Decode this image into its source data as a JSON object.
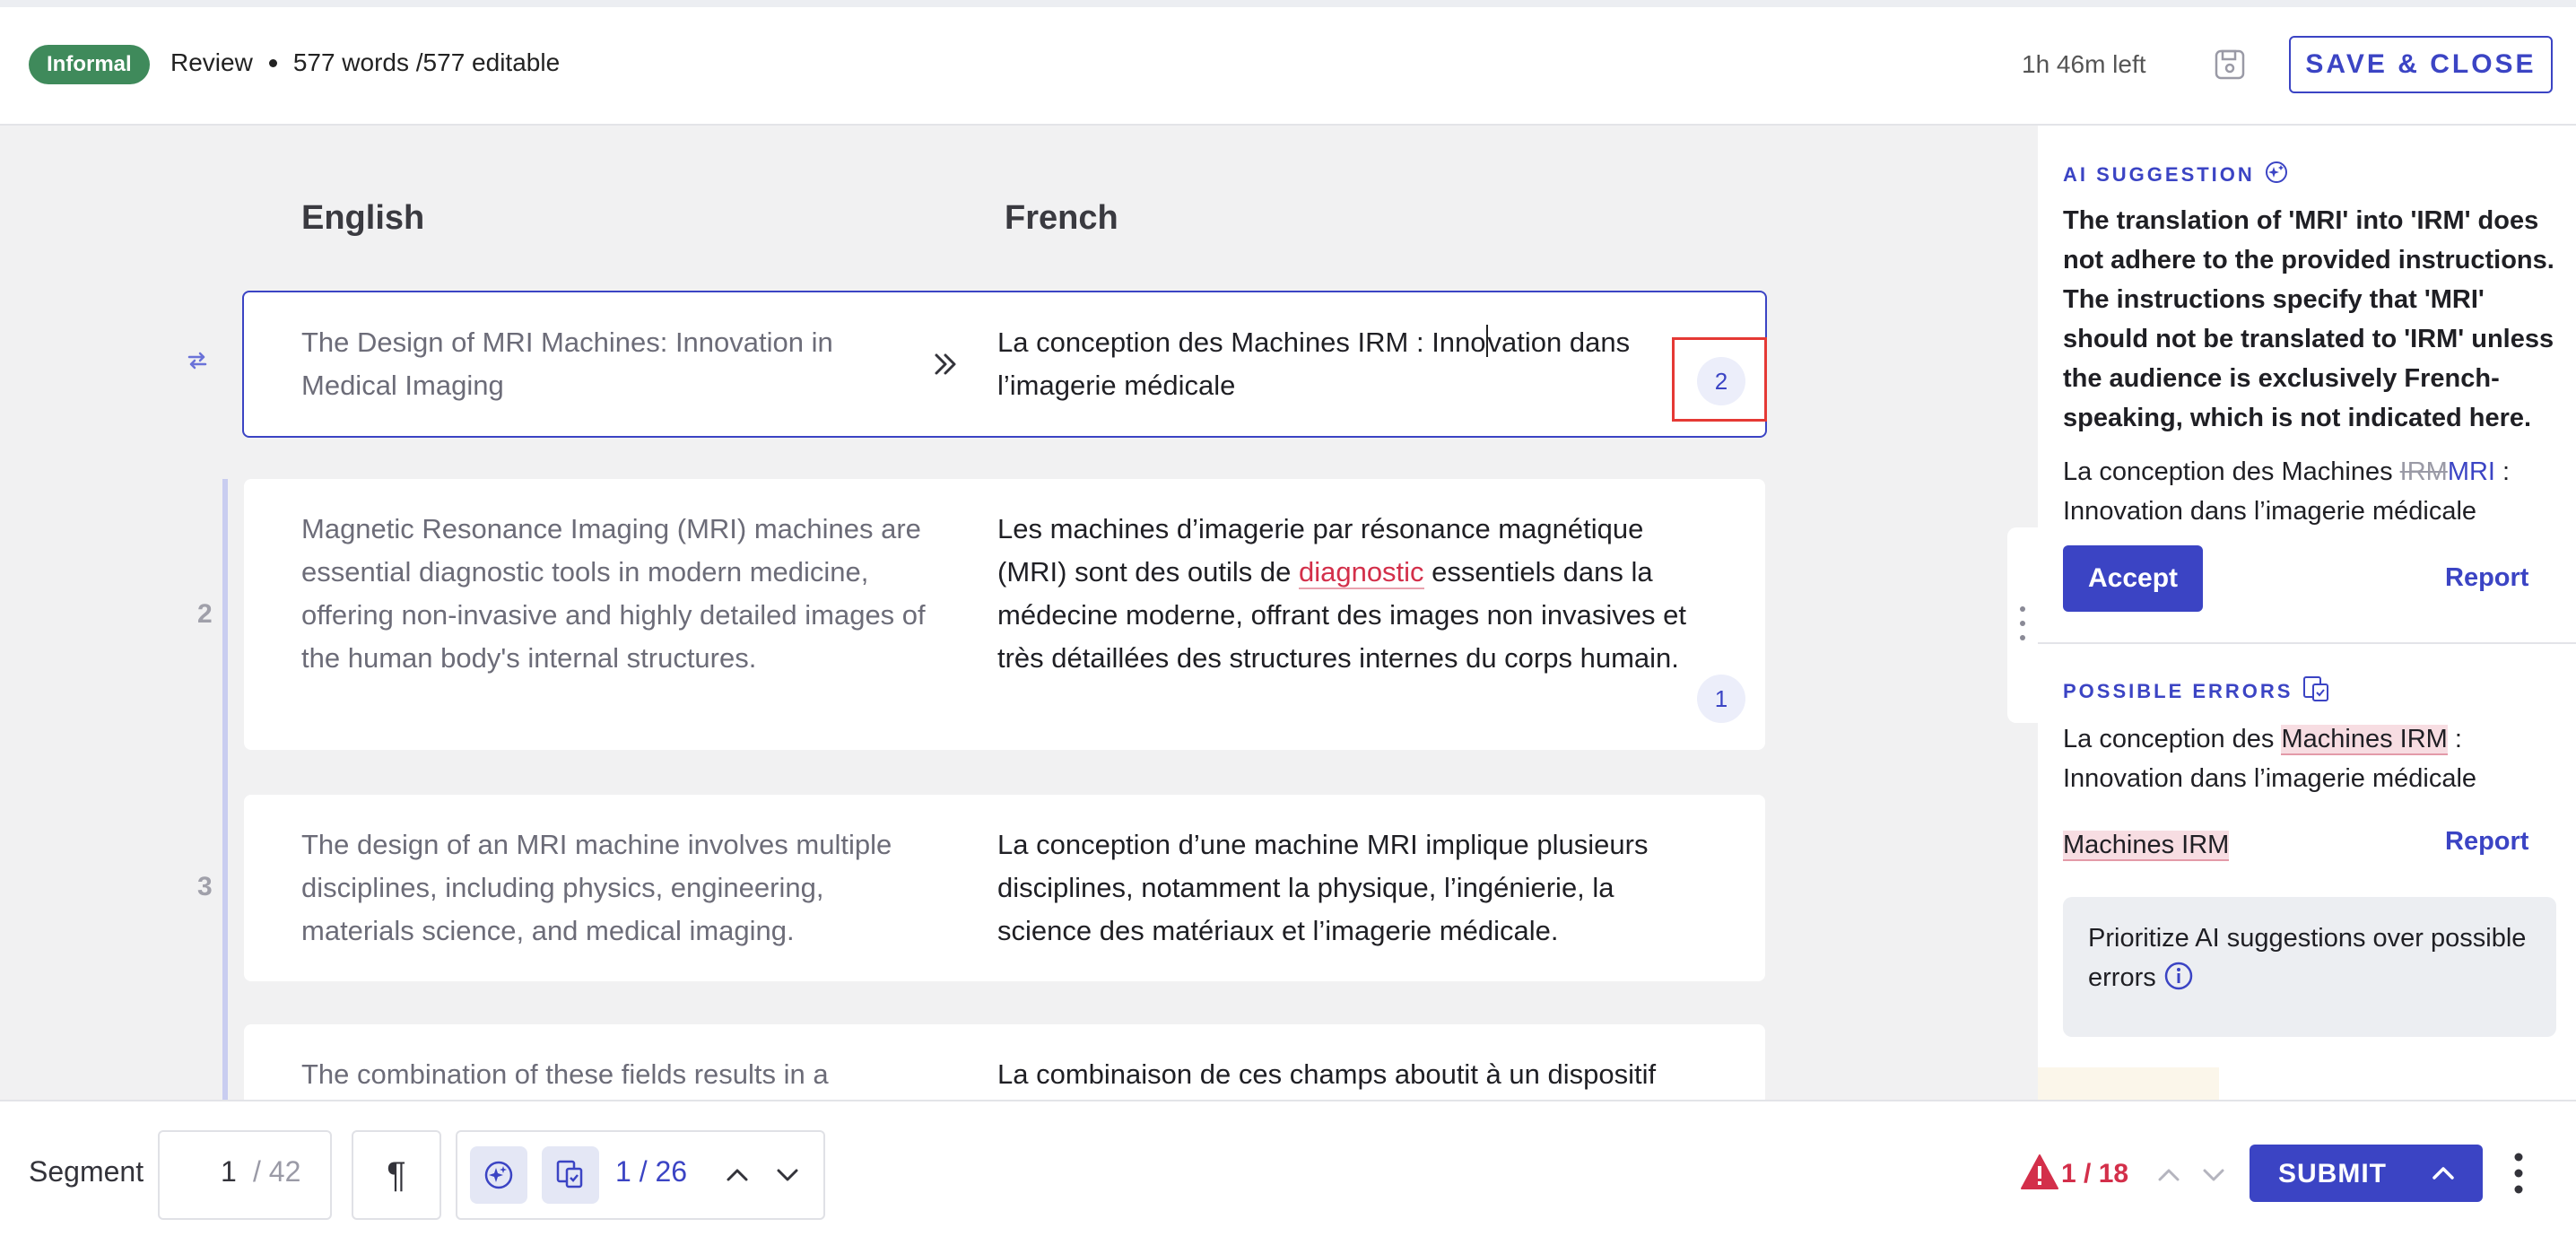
{
  "header": {
    "tone_badge": "Informal",
    "mode": "Review",
    "word_count": "577 words /577 editable",
    "time_left": "1h 46m left",
    "save_close_label": "SAVE & CLOSE"
  },
  "columns": {
    "source": "English",
    "target": "French"
  },
  "segments": [
    {
      "number": "",
      "source": "The Design of MRI Machines: Innovation in Medical Imaging",
      "target_before_caret": "La conception des Machines IRM : Inno",
      "target_after_caret": "vation dans l’imagerie médicale",
      "issue_count": "2"
    },
    {
      "number": "2",
      "source": "Magnetic Resonance Imaging (MRI) machines are essential diagnostic tools in modern medicine, offering non-invasive and highly detailed images of the human body's internal structures.",
      "target_part1": "Les machines d’imagerie par résonance magnétique (MRI) sont des outils de ",
      "target_error_word": "diagnostic",
      "target_part2": " essentiels dans la médecine moderne, offrant des images non invasives et très détaillées des structures internes du corps humain.",
      "issue_count": "1"
    },
    {
      "number": "3",
      "source": "The design of an MRI machine involves multiple disciplines, including physics, engineering, materials science, and medical imaging.",
      "target": "La conception d’une machine MRI implique plusieurs disciplines, notamment la physique, l’ingénierie, la science des matériaux et l’imagerie médicale."
    },
    {
      "number": "",
      "source": "The combination of these fields results in a",
      "target": "La combinaison de ces champs aboutit à un dispositif"
    }
  ],
  "panel": {
    "ai_label": "AI SUGGESTION",
    "ai_text": "The translation of 'MRI' into 'IRM' does not adhere to the provided instructions. The instructions specify that 'MRI' should not be translated to 'IRM' unless the audience is exclusively French-speaking, which is not indicated here.",
    "suggestion_prefix": "La conception des Machines ",
    "suggestion_removed": "IRM",
    "suggestion_added": "MRI",
    "suggestion_suffix": " : Innovation dans l’imagerie médicale",
    "accept_label": "Accept",
    "report_label": "Report",
    "errors_label": "POSSIBLE ERRORS",
    "errors_prefix": "La conception des ",
    "errors_highlight": "Machines IRM",
    "errors_suffix": " : Innovation dans l’imagerie médicale",
    "errors_term": "Machines IRM",
    "errors_report_label": "Report",
    "prioritize_text": "Prioritize AI suggestions over possible errors"
  },
  "bottom": {
    "segment_label": "Segment",
    "segment_current": "1",
    "segment_total": "/ 42",
    "pilcrow": "¶",
    "issue_nav": "1 / 26",
    "error_count": "1 / 18",
    "submit_label": "SUBMIT"
  },
  "colors": {
    "accent": "#3b44c4",
    "badge_green": "#3f8a5b",
    "error_red": "#d32f4a",
    "focus_outline": "#e53935"
  }
}
